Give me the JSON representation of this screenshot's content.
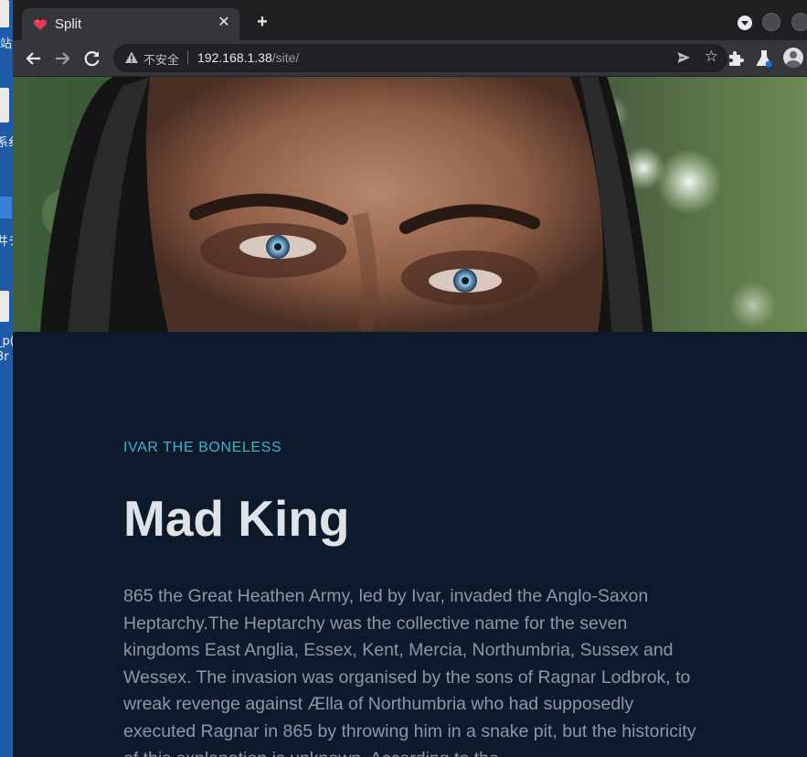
{
  "desktop": {
    "labels": [
      "站",
      "系纟",
      "井チ",
      "_p(",
      "3r"
    ]
  },
  "browser": {
    "tab": {
      "title": "Split",
      "favicon": "heart-icon"
    },
    "address_bar": {
      "security_label": "不安全",
      "host": "192.168.1.38",
      "path": "/site/"
    },
    "toolbar_icons": [
      "back-icon",
      "forward-icon",
      "reload-icon",
      "send-icon",
      "star-icon",
      "extensions-icon",
      "labs-icon",
      "profile-icon"
    ]
  },
  "page": {
    "hero_image": "hooded-man-eyes-photo",
    "eyebrow": "IVAR THE BONELESS",
    "headline": "Mad King",
    "body": "865 the Great Heathen Army, led by Ivar, invaded the Anglo-Saxon Heptarchy.The Heptarchy was the collective name for the seven kingdoms East Anglia, Essex, Kent, Mercia, Northumbria, Sussex and Wessex. The invasion was organised by the sons of Ragnar Lodbrok, to wreak revenge against Ælla of Northumbria who had supposedly executed Ragnar in 865 by throwing him in a snake pit, but the historicity of this explanation is unknown. According to the"
  },
  "colors": {
    "accent": "#3fb2cc",
    "page_bg": "#0c1a2b",
    "headline": "#dfe3e8",
    "body_text": "#8d97a6",
    "chrome_bg": "#35363a",
    "tabstrip_bg": "#1f2022",
    "favicon": "#e53950"
  }
}
